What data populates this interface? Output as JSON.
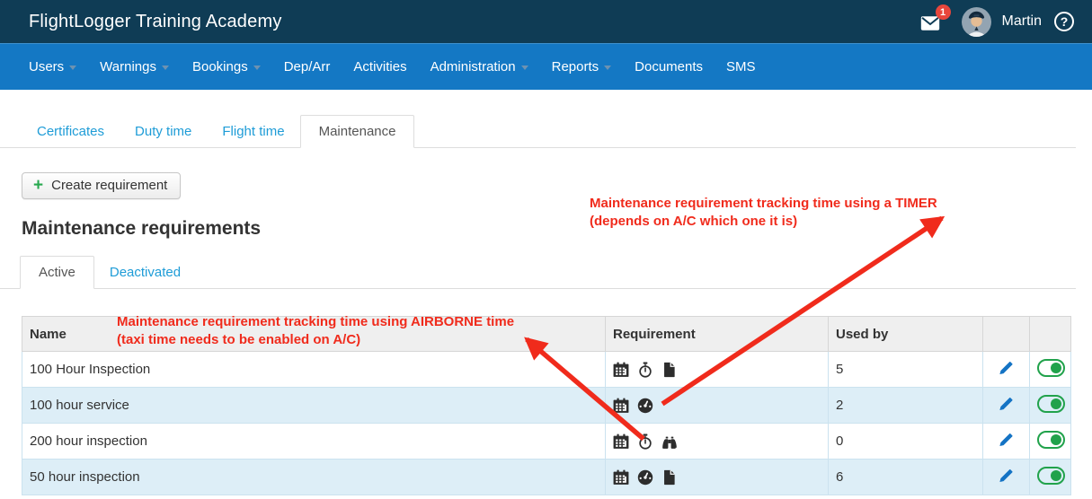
{
  "header": {
    "brand": "FlightLogger Training Academy",
    "mail_badge": "1",
    "user_name": "Martin",
    "help_glyph": "?"
  },
  "nav": {
    "items": [
      {
        "label": "Users",
        "has_dropdown": true
      },
      {
        "label": "Warnings",
        "has_dropdown": true
      },
      {
        "label": "Bookings",
        "has_dropdown": true
      },
      {
        "label": "Dep/Arr",
        "has_dropdown": false
      },
      {
        "label": "Activities",
        "has_dropdown": false
      },
      {
        "label": "Administration",
        "has_dropdown": true
      },
      {
        "label": "Reports",
        "has_dropdown": true
      },
      {
        "label": "Documents",
        "has_dropdown": false
      },
      {
        "label": "SMS",
        "has_dropdown": false
      }
    ]
  },
  "page_tabs": [
    {
      "label": "Certificates",
      "active": false
    },
    {
      "label": "Duty time",
      "active": false
    },
    {
      "label": "Flight time",
      "active": false
    },
    {
      "label": "Maintenance",
      "active": true
    }
  ],
  "toolbar": {
    "plus_glyph": "+",
    "create_label": "Create requirement"
  },
  "section": {
    "title": "Maintenance requirements"
  },
  "filter_tabs": [
    {
      "label": "Active",
      "active": true
    },
    {
      "label": "Deactivated",
      "active": false
    }
  ],
  "annotations": {
    "timer": {
      "line1": "Maintenance requirement tracking time using a TIMER",
      "line2": "(depends on A/C which one it is)"
    },
    "airborne": {
      "line1": "Maintenance requirement tracking time using AIRBORNE time",
      "line2": "(taxi time needs to be enabled on A/C)"
    }
  },
  "table": {
    "columns": [
      "Name",
      "Requirement",
      "Used by"
    ],
    "rows": [
      {
        "name": "100 Hour Inspection",
        "icons": [
          "calendar",
          "stopwatch",
          "file"
        ],
        "used_by": "5"
      },
      {
        "name": "100 hour service",
        "icons": [
          "calendar",
          "gauge"
        ],
        "used_by": "2"
      },
      {
        "name": "200 hour inspection",
        "icons": [
          "calendar",
          "stopwatch",
          "binoculars"
        ],
        "used_by": "0"
      },
      {
        "name": "50 hour inspection",
        "icons": [
          "calendar",
          "gauge",
          "file"
        ],
        "used_by": "6"
      }
    ]
  },
  "colors": {
    "header_bg": "#0f3c55",
    "nav_bg": "#1478c4",
    "link_blue": "#1e9cd7",
    "annotation_red": "#f02b1c",
    "toggle_green": "#21a24b",
    "pencil_blue": "#1473c4",
    "row_alt_blue": "#ddeef7",
    "badge_red": "#e8463c",
    "plus_green": "#27a84e"
  }
}
